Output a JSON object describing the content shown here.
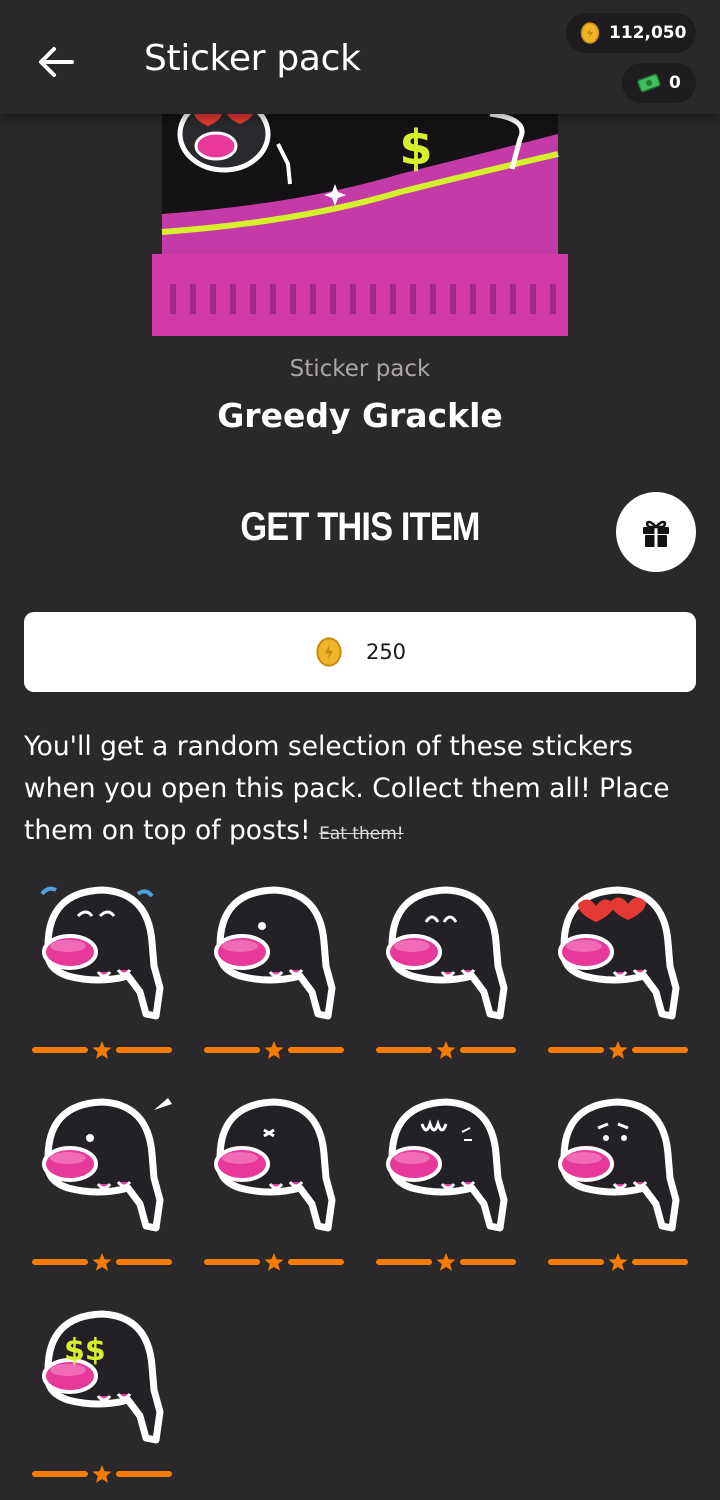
{
  "header": {
    "title": "Sticker pack",
    "coins": "112,050",
    "cash": "0"
  },
  "item": {
    "type_label": "Sticker pack",
    "name": "Greedy Grackle"
  },
  "purchase": {
    "heading": "GET THIS ITEM",
    "price": "250"
  },
  "description": {
    "text": "You'll get a random selection of these stickers when you open this pack. Collect them all! Place them on top of posts!",
    "strike": "Eat them!"
  },
  "stickers": [
    {
      "variant": "crying",
      "stars": 1
    },
    {
      "variant": "plain",
      "stars": 1
    },
    {
      "variant": "happy",
      "stars": 1
    },
    {
      "variant": "heart-eyes",
      "stars": 1
    },
    {
      "variant": "shouting",
      "stars": 1
    },
    {
      "variant": "winking",
      "stars": 1
    },
    {
      "variant": "scared",
      "stars": 1
    },
    {
      "variant": "worried",
      "stars": 1
    },
    {
      "variant": "dollar-eyes",
      "stars": 1
    }
  ],
  "colors": {
    "background": "#2b282b",
    "accent_orange": "#f57c00",
    "beak_pink": "#e8399a",
    "pack_magenta": "#c43aa6",
    "pack_lime": "#d7f02e"
  }
}
